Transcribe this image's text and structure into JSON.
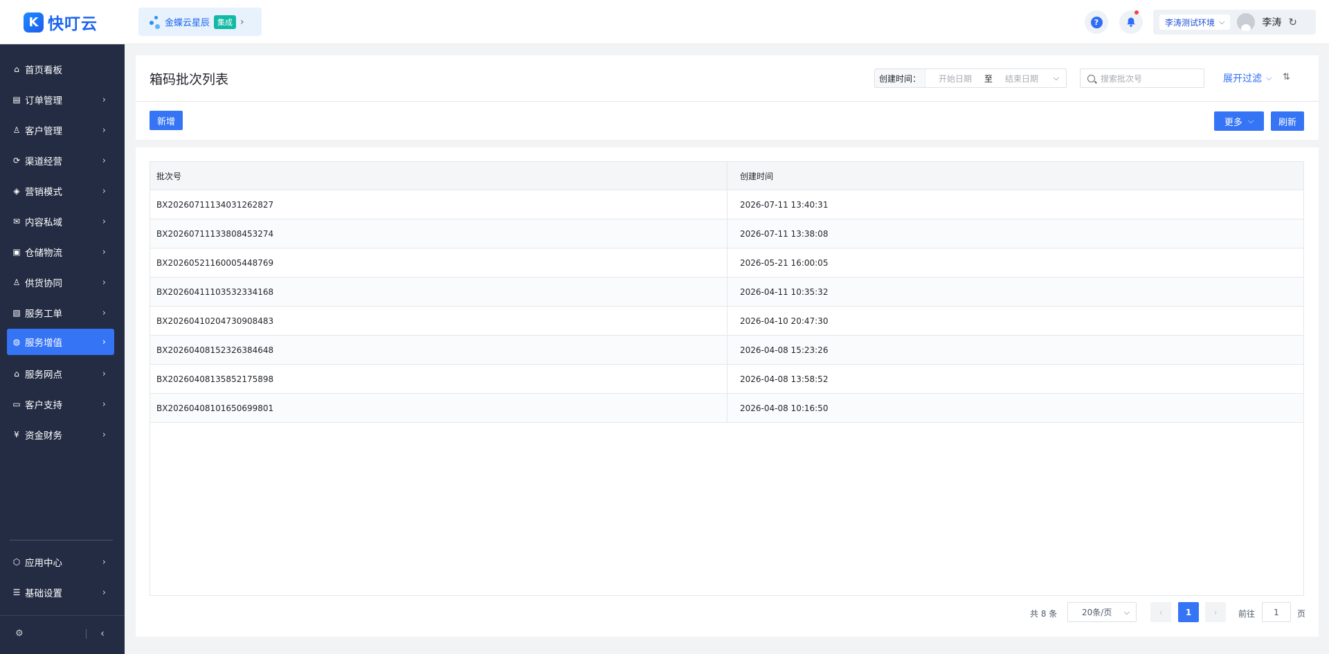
{
  "app": {
    "logo_text": "快叮云"
  },
  "integration": {
    "label": "金蝶云星辰",
    "badge": "集成",
    "arrow": "›"
  },
  "topbar": {
    "help_glyph": "?",
    "bell_glyph": "🔔",
    "env_label": "李涛测试环境",
    "user_name": "李涛"
  },
  "sidebar": {
    "items": [
      {
        "label": "首页看板",
        "icon": "home-icon"
      },
      {
        "label": "订单管理",
        "icon": "order-icon"
      },
      {
        "label": "客户管理",
        "icon": "user-icon"
      },
      {
        "label": "渠道经营",
        "icon": "channel-icon"
      },
      {
        "label": "营销模式",
        "icon": "tag-icon"
      },
      {
        "label": "内容私域",
        "icon": "content-icon"
      },
      {
        "label": "仓储物流",
        "icon": "warehouse-icon"
      },
      {
        "label": "供货协同",
        "icon": "supply-icon"
      },
      {
        "label": "服务工单",
        "icon": "workorder-icon"
      },
      {
        "label": "服务增值",
        "icon": "bag-icon"
      },
      {
        "label": "服务网点",
        "icon": "store-icon"
      },
      {
        "label": "客户支持",
        "icon": "support-icon"
      },
      {
        "label": "资金财务",
        "icon": "finance-icon"
      }
    ],
    "bottom_items": [
      {
        "label": "应用中心",
        "icon": "app-center-icon"
      },
      {
        "label": "基础设置",
        "icon": "settings-icon"
      }
    ],
    "active_index": 9
  },
  "header": {
    "title": "箱码批次列表",
    "date_label": "创建时间：",
    "date_start_placeholder": "开始日期",
    "date_to": "至",
    "date_end_placeholder": "结束日期",
    "search_placeholder": "搜索批次号",
    "expand_filter": "展开过滤",
    "add_label": "新增",
    "more_label": "更多",
    "refresh_label": "刷新"
  },
  "table": {
    "columns": [
      "批次号",
      "创建时间"
    ],
    "rows": [
      [
        "BX20260711134031262827",
        "2026-07-11 13:40:31"
      ],
      [
        "BX20260711133808453274",
        "2026-07-11 13:38:08"
      ],
      [
        "BX20260521160005448769",
        "2026-05-21 16:00:05"
      ],
      [
        "BX20260411103532334168",
        "2026-04-11 10:35:32"
      ],
      [
        "BX20260410204730908483",
        "2026-04-10 20:47:30"
      ],
      [
        "BX20260408152326384648",
        "2026-04-08 15:23:26"
      ],
      [
        "BX20260408135852175898",
        "2026-04-08 13:58:52"
      ],
      [
        "BX20260408101650699801",
        "2026-04-08 10:16:50"
      ]
    ]
  },
  "pagination": {
    "total_text": "共 8 条",
    "page_size": "20条/页",
    "current_page": "1",
    "goto_label": "前往",
    "goto_value": "1",
    "page_suffix": "页"
  },
  "colors": {
    "primary": "#3574f5",
    "sidebar_bg": "#232c43"
  }
}
